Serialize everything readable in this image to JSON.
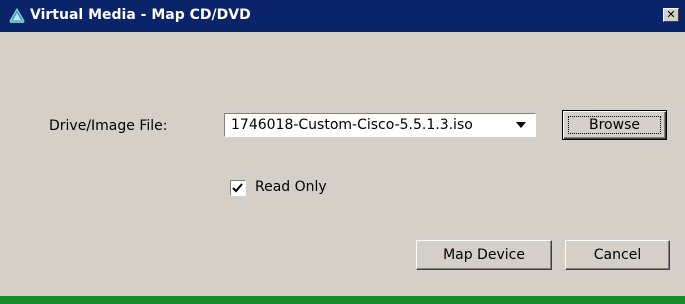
{
  "window": {
    "title": "Virtual Media - Map CD/DVD",
    "close_glyph": "✕",
    "titlebar_color": "#0a246a",
    "background_color": "#d4d0c8",
    "bottom_bar_color": "#168c2c"
  },
  "form": {
    "drive_label": "Drive/Image File:",
    "drive_value": "1746018-Custom-Cisco-5.5.1.3.iso",
    "read_only_label": "Read Only",
    "read_only_checked": true
  },
  "buttons": {
    "browse": "Browse",
    "map_device": "Map Device",
    "cancel": "Cancel"
  },
  "icons": {
    "title_icon": "virtual-media-icon",
    "dropdown_icon": "chevron-down-icon",
    "check_icon": "checkmark-icon"
  }
}
